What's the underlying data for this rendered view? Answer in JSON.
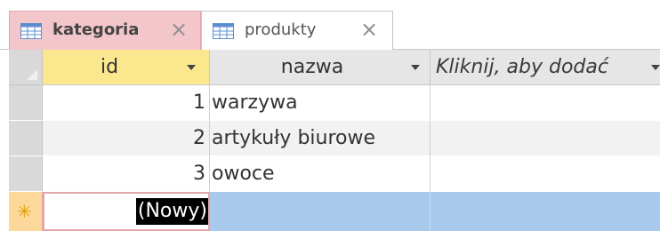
{
  "tabs": [
    {
      "label": "kategoria",
      "active": true,
      "icon": "table-icon",
      "close": "×"
    },
    {
      "label": "produkty",
      "active": false,
      "icon": "table-icon",
      "close": "×"
    }
  ],
  "columns": [
    {
      "label": "id"
    },
    {
      "label": "nazwa"
    },
    {
      "label": "Kliknij, aby dodać"
    }
  ],
  "rows": [
    {
      "id": "1",
      "nazwa": "warzywa"
    },
    {
      "id": "2",
      "nazwa": "artykuły biurowe"
    },
    {
      "id": "3",
      "nazwa": "owoce"
    }
  ],
  "new_row": {
    "marker": "✳",
    "id_placeholder": "(Nowy)"
  },
  "colors": {
    "active_tab": "#f3c6cb",
    "id_header": "#fbe88e",
    "row_alt": "#f2f2f2",
    "new_row_selected": "#a9c9ec",
    "new_row_selector": "#fcd89a",
    "new_row_border": "#e3a6ad",
    "new_marker": "#e0a000"
  }
}
